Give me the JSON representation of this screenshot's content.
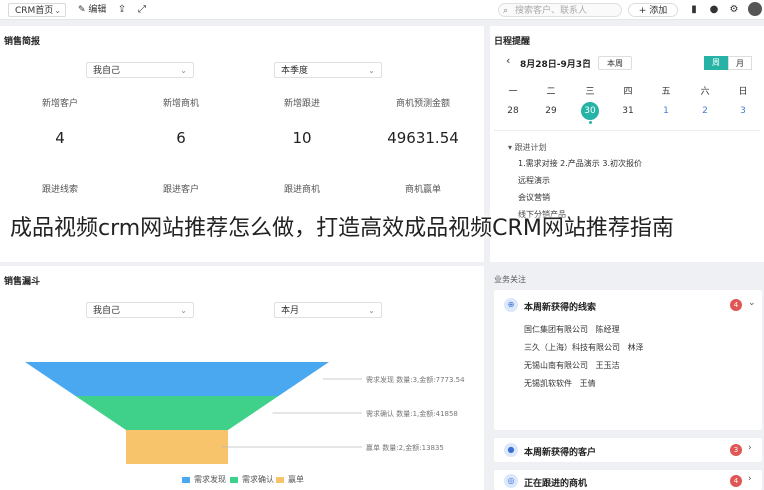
{
  "topbar": {
    "module_select": "CRM首页",
    "edit_label": "编辑",
    "search_placeholder": "搜索客户、联系人",
    "add_label": "添加"
  },
  "sales_brief": {
    "title": "销售简报",
    "scope_select": "我自己",
    "period_select": "本季度",
    "stats": [
      {
        "label": "新增客户",
        "value": "4"
      },
      {
        "label": "新增商机",
        "value": "6"
      },
      {
        "label": "新增跟进",
        "value": "10"
      },
      {
        "label": "商机预测金额",
        "value": "49631.54"
      }
    ],
    "second_row": [
      "跟进线索",
      "跟进客户",
      "跟进商机",
      "商机赢单"
    ]
  },
  "overlay_caption": "成品视频crm网站推荐怎么做，打造高效成品视频CRM网站推荐指南",
  "sales_funnel": {
    "title": "销售漏斗",
    "scope_select": "我自己",
    "period_select": "本月"
  },
  "chart_data": {
    "type": "funnel",
    "stages": [
      {
        "name": "需求发现",
        "count": 3,
        "amount": 7773.54,
        "color": "#4aa8f0",
        "label": "需求发现 数量:3,金额:7773.54"
      },
      {
        "name": "需求确认",
        "count": 1,
        "amount": 41858,
        "color": "#3fd08a",
        "label": "需求确认 数量:1,金额:41858"
      },
      {
        "name": "赢单",
        "count": 2,
        "amount": 13835,
        "color": "#f7c46c",
        "label": "赢单 数量:2,金额:13835"
      }
    ],
    "legend": [
      "需求发现",
      "需求确认",
      "赢单"
    ],
    "legend_position": "bottom"
  },
  "schedule": {
    "title": "日程提醒",
    "range": "8月28日-9月3日",
    "today_btn": "本周",
    "view_week": "周",
    "view_month": "月",
    "weekdays": [
      "一",
      "二",
      "三",
      "四",
      "五",
      "六",
      "日"
    ],
    "days": [
      "28",
      "29",
      "30",
      "31",
      "1",
      "2",
      "3"
    ],
    "today_index": 2,
    "items": [
      "跟进计划",
      "1.需求对接 2.产品演示 3.初次报价",
      "远程演示",
      "会议营销",
      "线下分销产品"
    ]
  },
  "business_follow": {
    "title": "业务关注",
    "cards": [
      {
        "title": "本周新获得的线索",
        "badge": "4",
        "rows": [
          {
            "company": "国仁集团有限公司",
            "contact": "陈经理"
          },
          {
            "company": "三久（上海）科技有限公司",
            "contact": "林泽"
          },
          {
            "company": "无锡山南有限公司",
            "contact": "王玉洁"
          },
          {
            "company": "无锡凯软软件",
            "contact": "王倩"
          }
        ]
      },
      {
        "title": "本周新获得的客户",
        "badge": "3"
      },
      {
        "title": "正在跟进的商机",
        "badge": "4"
      }
    ]
  },
  "colors": {
    "accent": "#26b3a6",
    "badge": "#e05656",
    "funnel_blue": "#4aa8f0",
    "funnel_green": "#3fd08a",
    "funnel_yellow": "#f7c46c"
  }
}
